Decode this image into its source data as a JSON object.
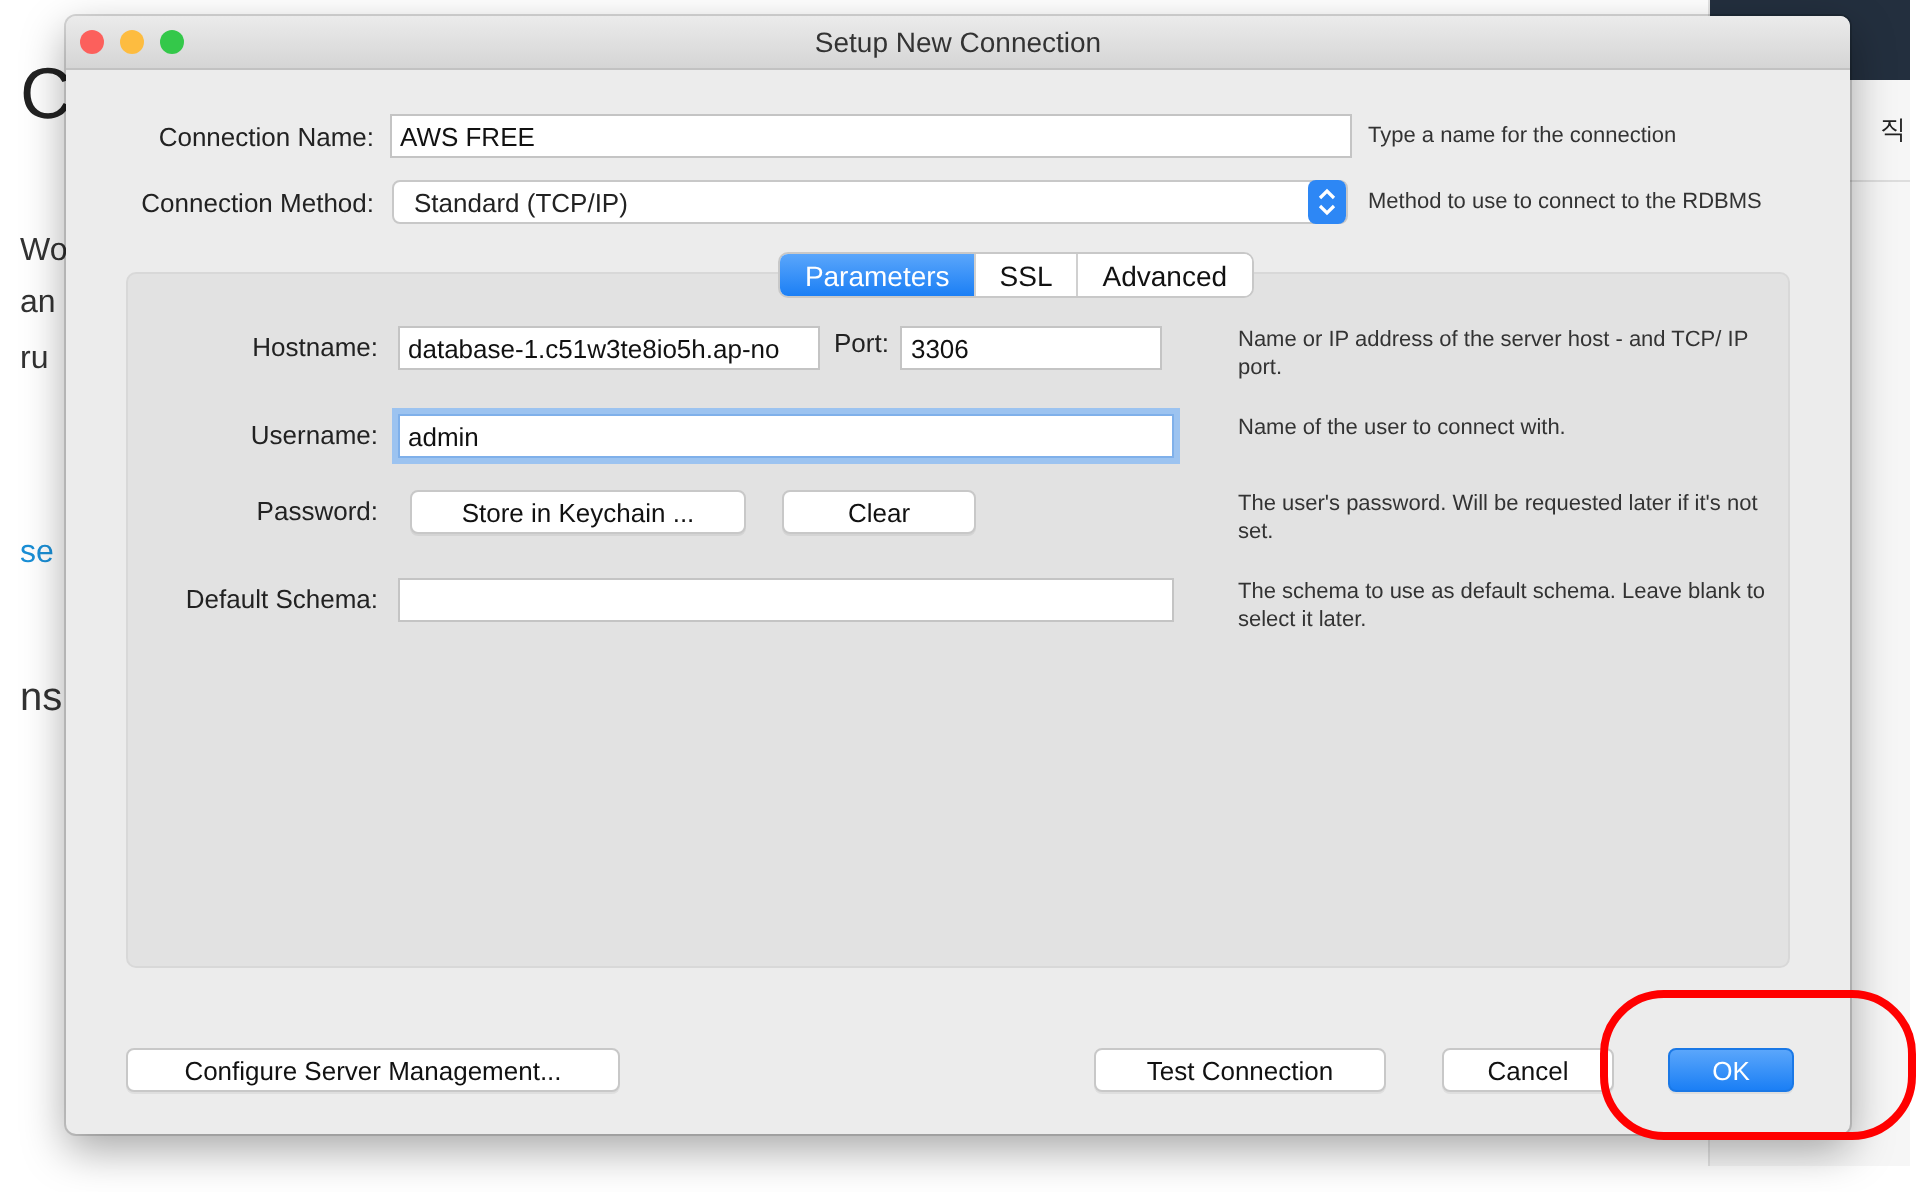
{
  "background": {
    "left_fragments": [
      {
        "text": "C",
        "kind": "heading"
      },
      {
        "text": "Wo",
        "kind": "body"
      },
      {
        "text": "an",
        "kind": "body"
      },
      {
        "text": "ru",
        "kind": "body"
      },
      {
        "text": "se",
        "kind": "link"
      },
      {
        "text": "ns",
        "kind": "subheading"
      }
    ],
    "right_fragments": [
      "직"
    ]
  },
  "window": {
    "title": "Setup New Connection"
  },
  "connection_name": {
    "label": "Connection Name:",
    "value": "AWS FREE",
    "hint": "Type a name for the connection"
  },
  "connection_method": {
    "label": "Connection Method:",
    "value": "Standard (TCP/IP)",
    "hint": "Method to use to connect to the RDBMS"
  },
  "tabs": [
    {
      "label": "Parameters",
      "selected": true
    },
    {
      "label": "SSL",
      "selected": false
    },
    {
      "label": "Advanced",
      "selected": false
    }
  ],
  "parameters": [
    {
      "kind": "text",
      "label": "Hostname:",
      "value": "database-1.c51w3te8io5h.ap-no",
      "focused": false,
      "port": {
        "label": "Port:",
        "value": "3306"
      },
      "hint": "Name or IP address of the server host - and TCP/ IP port."
    },
    {
      "kind": "text",
      "label": "Username:",
      "value": "admin",
      "focused": true,
      "hint": "Name of the user to connect with."
    },
    {
      "kind": "buttons",
      "label": "Password:",
      "buttons": [
        "Store in Keychain ...",
        "Clear"
      ],
      "hint": "The user's password. Will be requested later if it's not set."
    },
    {
      "kind": "text",
      "label": "Default Schema:",
      "focused": false,
      "hint": "The schema to use as default schema. Leave blank to select it later."
    }
  ],
  "footer_buttons": [
    {
      "label": "Configure Server Management...",
      "default": false,
      "highlighted": false
    },
    {
      "label": "Test Connection",
      "default": false,
      "highlighted": false
    },
    {
      "label": "Cancel",
      "default": false,
      "highlighted": false
    },
    {
      "label": "OK",
      "default": true,
      "highlighted": true
    }
  ]
}
